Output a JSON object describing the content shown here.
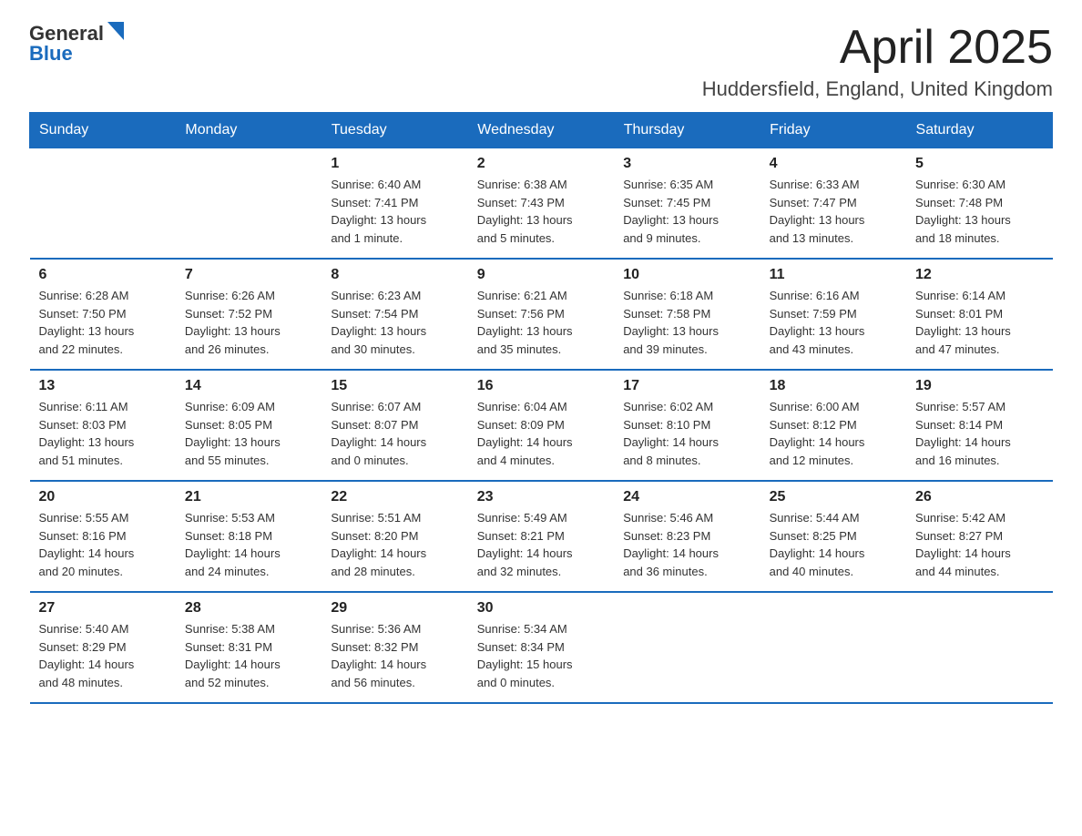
{
  "header": {
    "logo": {
      "text_general": "General",
      "text_blue": "Blue"
    },
    "title": "April 2025",
    "subtitle": "Huddersfield, England, United Kingdom"
  },
  "calendar": {
    "days_of_week": [
      "Sunday",
      "Monday",
      "Tuesday",
      "Wednesday",
      "Thursday",
      "Friday",
      "Saturday"
    ],
    "weeks": [
      [
        {
          "day": "",
          "info": ""
        },
        {
          "day": "",
          "info": ""
        },
        {
          "day": "1",
          "info": "Sunrise: 6:40 AM\nSunset: 7:41 PM\nDaylight: 13 hours\nand 1 minute."
        },
        {
          "day": "2",
          "info": "Sunrise: 6:38 AM\nSunset: 7:43 PM\nDaylight: 13 hours\nand 5 minutes."
        },
        {
          "day": "3",
          "info": "Sunrise: 6:35 AM\nSunset: 7:45 PM\nDaylight: 13 hours\nand 9 minutes."
        },
        {
          "day": "4",
          "info": "Sunrise: 6:33 AM\nSunset: 7:47 PM\nDaylight: 13 hours\nand 13 minutes."
        },
        {
          "day": "5",
          "info": "Sunrise: 6:30 AM\nSunset: 7:48 PM\nDaylight: 13 hours\nand 18 minutes."
        }
      ],
      [
        {
          "day": "6",
          "info": "Sunrise: 6:28 AM\nSunset: 7:50 PM\nDaylight: 13 hours\nand 22 minutes."
        },
        {
          "day": "7",
          "info": "Sunrise: 6:26 AM\nSunset: 7:52 PM\nDaylight: 13 hours\nand 26 minutes."
        },
        {
          "day": "8",
          "info": "Sunrise: 6:23 AM\nSunset: 7:54 PM\nDaylight: 13 hours\nand 30 minutes."
        },
        {
          "day": "9",
          "info": "Sunrise: 6:21 AM\nSunset: 7:56 PM\nDaylight: 13 hours\nand 35 minutes."
        },
        {
          "day": "10",
          "info": "Sunrise: 6:18 AM\nSunset: 7:58 PM\nDaylight: 13 hours\nand 39 minutes."
        },
        {
          "day": "11",
          "info": "Sunrise: 6:16 AM\nSunset: 7:59 PM\nDaylight: 13 hours\nand 43 minutes."
        },
        {
          "day": "12",
          "info": "Sunrise: 6:14 AM\nSunset: 8:01 PM\nDaylight: 13 hours\nand 47 minutes."
        }
      ],
      [
        {
          "day": "13",
          "info": "Sunrise: 6:11 AM\nSunset: 8:03 PM\nDaylight: 13 hours\nand 51 minutes."
        },
        {
          "day": "14",
          "info": "Sunrise: 6:09 AM\nSunset: 8:05 PM\nDaylight: 13 hours\nand 55 minutes."
        },
        {
          "day": "15",
          "info": "Sunrise: 6:07 AM\nSunset: 8:07 PM\nDaylight: 14 hours\nand 0 minutes."
        },
        {
          "day": "16",
          "info": "Sunrise: 6:04 AM\nSunset: 8:09 PM\nDaylight: 14 hours\nand 4 minutes."
        },
        {
          "day": "17",
          "info": "Sunrise: 6:02 AM\nSunset: 8:10 PM\nDaylight: 14 hours\nand 8 minutes."
        },
        {
          "day": "18",
          "info": "Sunrise: 6:00 AM\nSunset: 8:12 PM\nDaylight: 14 hours\nand 12 minutes."
        },
        {
          "day": "19",
          "info": "Sunrise: 5:57 AM\nSunset: 8:14 PM\nDaylight: 14 hours\nand 16 minutes."
        }
      ],
      [
        {
          "day": "20",
          "info": "Sunrise: 5:55 AM\nSunset: 8:16 PM\nDaylight: 14 hours\nand 20 minutes."
        },
        {
          "day": "21",
          "info": "Sunrise: 5:53 AM\nSunset: 8:18 PM\nDaylight: 14 hours\nand 24 minutes."
        },
        {
          "day": "22",
          "info": "Sunrise: 5:51 AM\nSunset: 8:20 PM\nDaylight: 14 hours\nand 28 minutes."
        },
        {
          "day": "23",
          "info": "Sunrise: 5:49 AM\nSunset: 8:21 PM\nDaylight: 14 hours\nand 32 minutes."
        },
        {
          "day": "24",
          "info": "Sunrise: 5:46 AM\nSunset: 8:23 PM\nDaylight: 14 hours\nand 36 minutes."
        },
        {
          "day": "25",
          "info": "Sunrise: 5:44 AM\nSunset: 8:25 PM\nDaylight: 14 hours\nand 40 minutes."
        },
        {
          "day": "26",
          "info": "Sunrise: 5:42 AM\nSunset: 8:27 PM\nDaylight: 14 hours\nand 44 minutes."
        }
      ],
      [
        {
          "day": "27",
          "info": "Sunrise: 5:40 AM\nSunset: 8:29 PM\nDaylight: 14 hours\nand 48 minutes."
        },
        {
          "day": "28",
          "info": "Sunrise: 5:38 AM\nSunset: 8:31 PM\nDaylight: 14 hours\nand 52 minutes."
        },
        {
          "day": "29",
          "info": "Sunrise: 5:36 AM\nSunset: 8:32 PM\nDaylight: 14 hours\nand 56 minutes."
        },
        {
          "day": "30",
          "info": "Sunrise: 5:34 AM\nSunset: 8:34 PM\nDaylight: 15 hours\nand 0 minutes."
        },
        {
          "day": "",
          "info": ""
        },
        {
          "day": "",
          "info": ""
        },
        {
          "day": "",
          "info": ""
        }
      ]
    ]
  }
}
